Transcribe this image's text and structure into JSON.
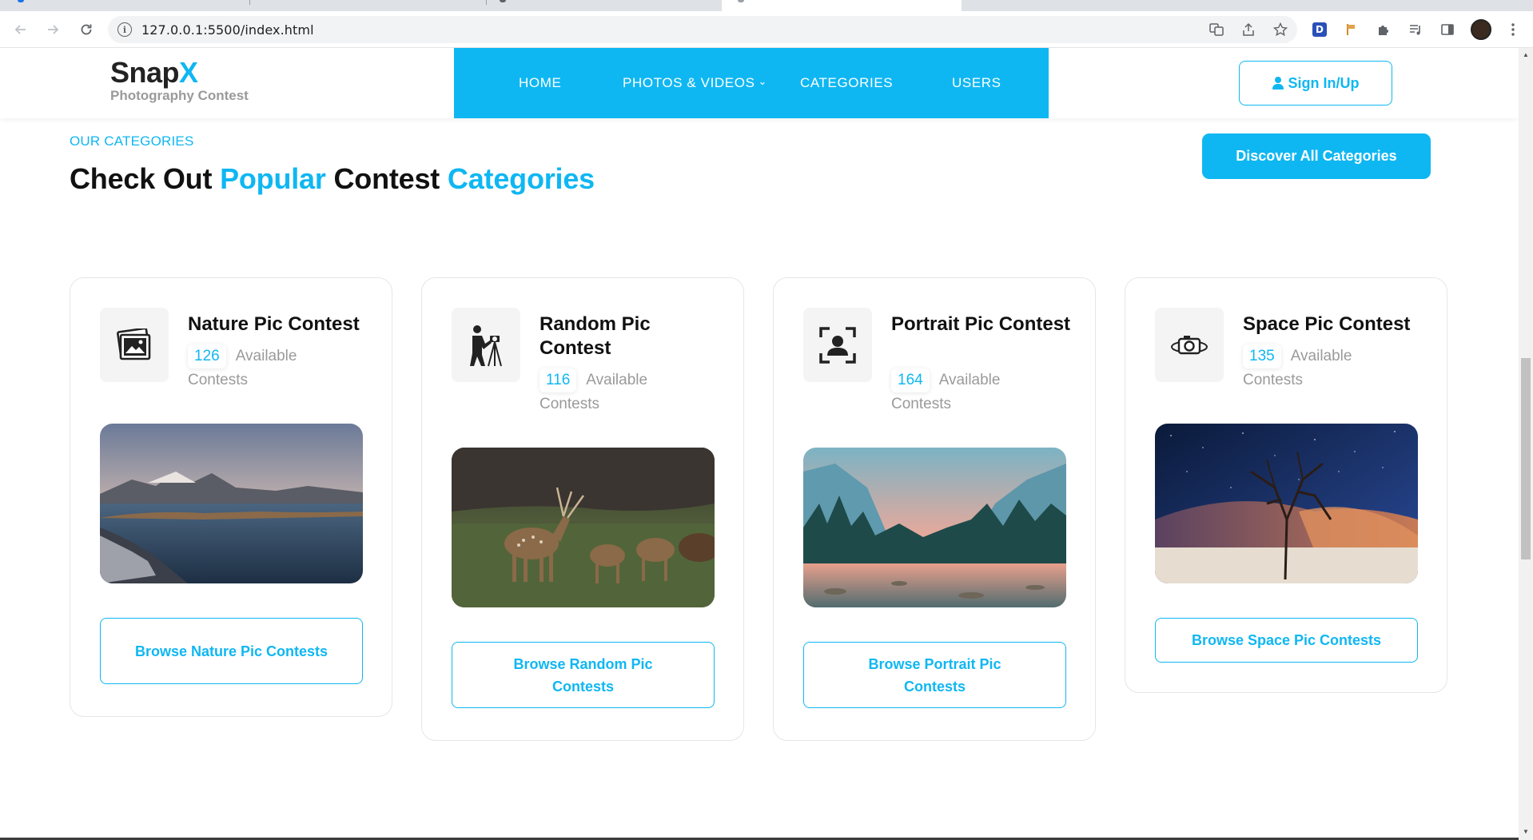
{
  "browser": {
    "url": "127.0.0.1:5500/index.html"
  },
  "site": {
    "logo_main": "Snap",
    "logo_accent": "X",
    "logo_sub": "Photography Contest",
    "nav": [
      "HOME",
      "PHOTOS & VIDEOS",
      "CATEGORIES",
      "USERS"
    ],
    "sign_in_label": "Sign In/Up"
  },
  "section": {
    "eyebrow": "OUR CATEGORIES",
    "headline_1": "Check Out",
    "headline_2": "Popular",
    "headline_3": "Contest",
    "headline_4": "Categories",
    "discover_label": "Discover All Categories"
  },
  "cards": [
    {
      "title": "Nature Pic Contest",
      "count": "126",
      "suffix": "Available Contests",
      "button": "Browse Nature Pic Contests",
      "icon": "photos-icon"
    },
    {
      "title": "Random Pic Contest",
      "count": "116",
      "suffix": "Available Contests",
      "button": "Browse Random Pic Contests",
      "icon": "photographer-icon"
    },
    {
      "title": "Portrait Pic Contest",
      "count": "164",
      "suffix": "Available Contests",
      "button": "Browse Portrait Pic Contests",
      "icon": "portrait-focus-icon"
    },
    {
      "title": "Space Pic Contest",
      "count": "135",
      "suffix": "Available Contests",
      "button": "Browse Space Pic Contests",
      "icon": "camera-orbit-icon"
    }
  ],
  "colors": {
    "accent": "#0fb7f2"
  }
}
